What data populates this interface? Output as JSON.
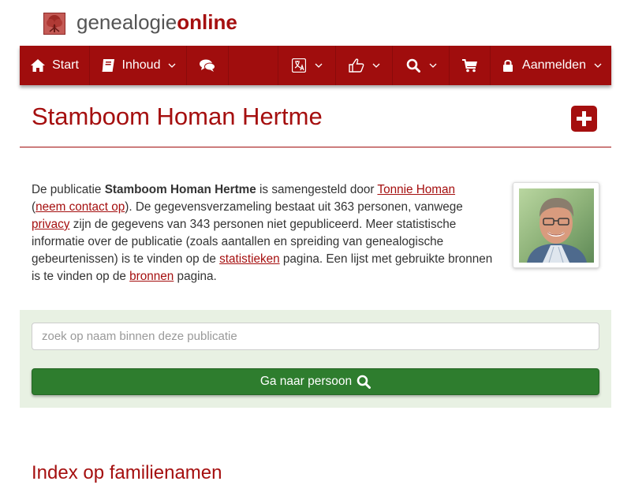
{
  "logo": {
    "text_plain": "genealogie",
    "text_accent": "online"
  },
  "nav": {
    "start_label": "Start",
    "inhoud_label": "Inhoud",
    "login_label": "Aanmelden"
  },
  "title": "Stamboom Homan Hertme",
  "intro": {
    "t1": "De publicatie ",
    "publication": "Stamboom Homan Hertme",
    "t2": " is samengesteld door ",
    "author": "Tonnie Homan",
    "t3": " (",
    "contact": "neem contact op",
    "t4": "). De gegevensverzameling bestaat uit 363 personen, vanwege ",
    "privacy": "privacy",
    "t5": " zijn de gegevens van 343 personen niet gepubliceerd. Meer statistische informatie over de publicatie (zoals aantallen en spreiding van genealogische gebeurtenissen) is te vinden op de ",
    "stats": "statistieken",
    "t6": " pagina. Een lijst met gebruikte bronnen is te vinden op de ",
    "sources": "bronnen",
    "t7": " pagina."
  },
  "search": {
    "placeholder": "zoek op naam binnen deze publicatie",
    "button_label": "Ga naar persoon"
  },
  "section_heading": "Index op familienamen",
  "colors": {
    "brand_red": "#a00d0d",
    "button_green": "#2e7d2e",
    "panel_green": "#e8f1e3"
  }
}
